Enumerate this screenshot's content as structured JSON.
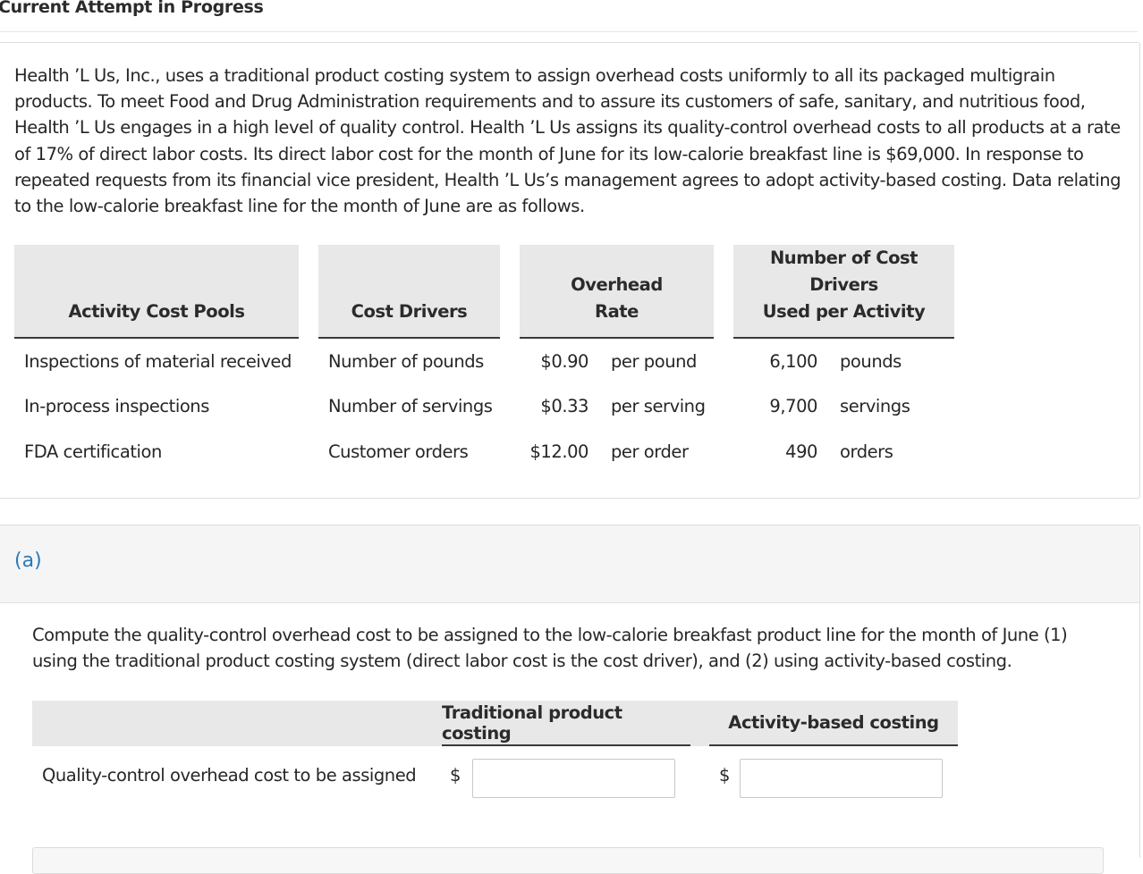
{
  "header": {
    "title": "Current Attempt in Progress"
  },
  "problem": {
    "text": "Health ’L Us, Inc., uses a traditional product costing system to assign overhead costs uniformly to all its packaged multigrain products. To meet Food and Drug Administration requirements and to assure its customers of safe, sanitary, and nutritious food, Health ’L Us engages in a high level of quality control. Health ’L Us assigns its quality-control overhead costs to all products at a rate of 17% of direct labor costs. Its direct labor cost for the month of June for its low-calorie breakfast line is $69,000. In response to repeated requests from its financial vice president, Health ’L Us’s management agrees to adopt activity-based costing. Data relating to the low-calorie breakfast line for the month of June are as follows."
  },
  "table": {
    "headers": {
      "pools": "Activity Cost Pools",
      "drivers": "Cost Drivers",
      "rate_line1": "Overhead",
      "rate_line2": "Rate",
      "num_line1": "Number of Cost Drivers",
      "num_line2": "Used per Activity"
    },
    "rows": [
      {
        "pool": "Inspections of material received",
        "driver": "Number of pounds",
        "rate": "$0.90",
        "rate_unit": "per pound",
        "num": "6,100",
        "num_unit": "pounds"
      },
      {
        "pool": "In-process inspections",
        "driver": "Number of servings",
        "rate": "$0.33",
        "rate_unit": "per serving",
        "num": "9,700",
        "num_unit": "servings"
      },
      {
        "pool": "FDA certification",
        "driver": "Customer orders",
        "rate": "$12.00",
        "rate_unit": "per order",
        "num": "490",
        "num_unit": "orders"
      }
    ]
  },
  "part_a": {
    "label": "(a)",
    "question": "Compute the quality-control overhead cost to be assigned to the low-calorie breakfast product line for the month of June (1) using the traditional product costing system (direct labor cost is the cost driver), and (2) using activity-based costing.",
    "col_traditional": "Traditional product costing",
    "col_abc": "Activity-based costing",
    "row_label": "Quality-control overhead cost to be assigned",
    "currency": "$",
    "traditional_value": "",
    "abc_value": ""
  }
}
